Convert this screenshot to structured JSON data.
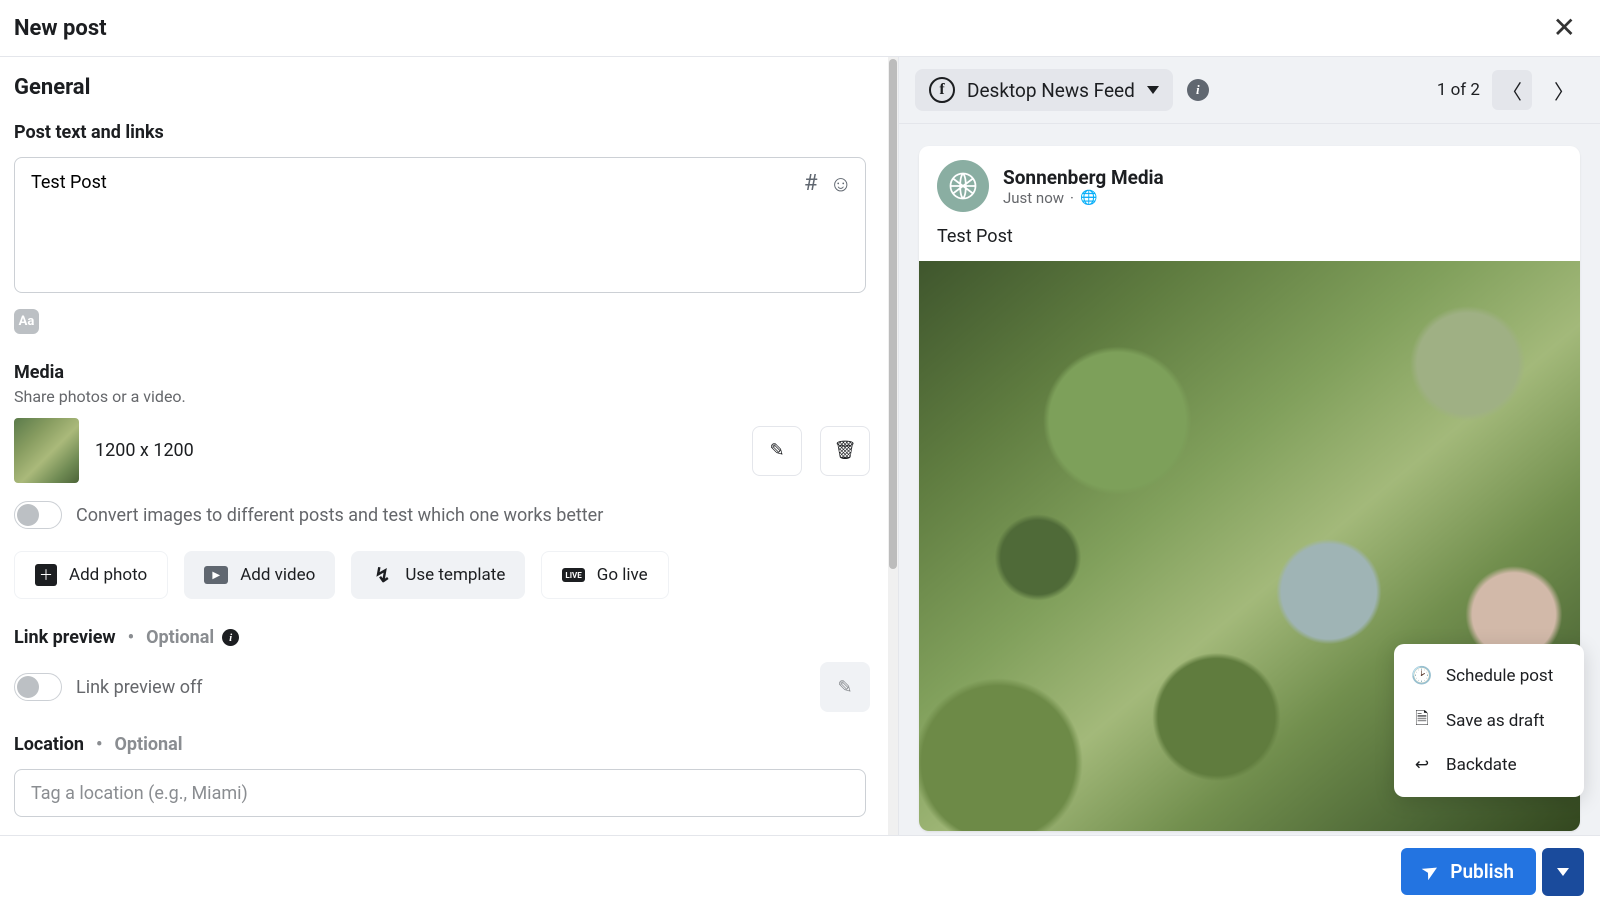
{
  "header": {
    "title": "New post"
  },
  "general": {
    "heading": "General",
    "post_text_label": "Post text and links",
    "post_text_value": "Test Post",
    "aa_badge": "Aa"
  },
  "media": {
    "label": "Media",
    "sub": "Share photos or a video.",
    "dimensions": "1200 x 1200",
    "convert_toggle_label": "Convert images to different posts and test which one works better",
    "buttons": {
      "add_photo": "Add photo",
      "add_video": "Add video",
      "use_template": "Use template",
      "go_live": "Go live",
      "live_badge": "LIVE"
    }
  },
  "link_preview": {
    "label": "Link preview",
    "optional": "Optional",
    "toggle_label": "Link preview off"
  },
  "location": {
    "label": "Location",
    "optional": "Optional",
    "placeholder": "Tag a location (e.g., Miami)"
  },
  "preview": {
    "feed_selector": "Desktop News Feed",
    "pager": "1 of 2",
    "page_name": "Sonnenberg Media",
    "time": "Just now",
    "separator": "·",
    "post_text": "Test Post"
  },
  "popover": {
    "schedule": "Schedule post",
    "draft": "Save as draft",
    "backdate": "Backdate"
  },
  "footer": {
    "publish": "Publish"
  }
}
